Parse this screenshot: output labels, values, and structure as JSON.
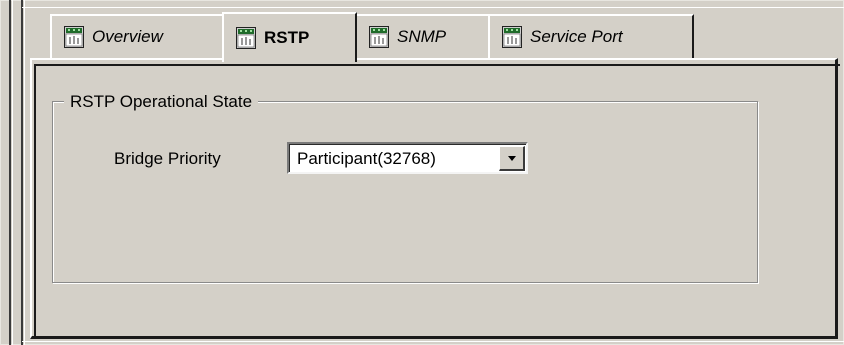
{
  "tabs": [
    {
      "label": "Overview",
      "active": false,
      "icon": "module-icon"
    },
    {
      "label": "RSTP",
      "active": true,
      "icon": "module-icon"
    },
    {
      "label": "SNMP",
      "active": false,
      "icon": "module-icon"
    },
    {
      "label": "Service Port",
      "active": false,
      "icon": "module-icon"
    }
  ],
  "group": {
    "title": "RSTP Operational State",
    "bridge_priority": {
      "label": "Bridge Priority",
      "value": "Participant(32768)"
    }
  }
}
